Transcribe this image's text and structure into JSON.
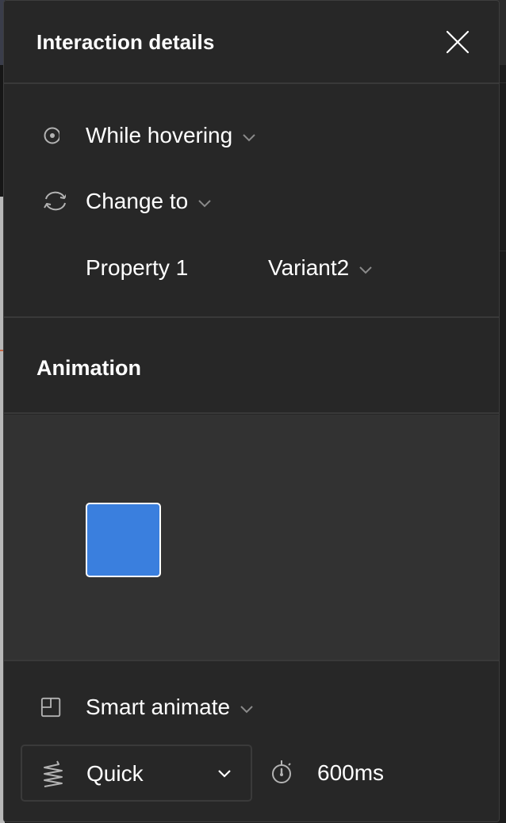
{
  "panel": {
    "title": "Interaction details",
    "close_icon": "close-icon"
  },
  "trigger": {
    "icon": "hover-target-icon",
    "label": "While hovering",
    "has_dropdown": true
  },
  "action": {
    "icon": "swap-arrows-icon",
    "label": "Change to",
    "has_dropdown": true
  },
  "property": {
    "name": "Property 1",
    "value": "Variant2",
    "has_dropdown": true
  },
  "animation": {
    "section_title": "Animation",
    "preview_color": "#3a7fde",
    "type": {
      "icon": "smart-animate-icon",
      "label": "Smart animate"
    },
    "easing": {
      "icon": "spring-icon",
      "label": "Quick"
    },
    "duration": {
      "icon": "stopwatch-icon",
      "value": "600ms"
    }
  },
  "colors": {
    "panel_bg": "#272727",
    "preview_bg": "#323232",
    "divider": "#393939",
    "text": "#ffffff",
    "icon": "#b3b3b3",
    "chevron": "#8a8a8a",
    "accent": "#3a7fde"
  }
}
